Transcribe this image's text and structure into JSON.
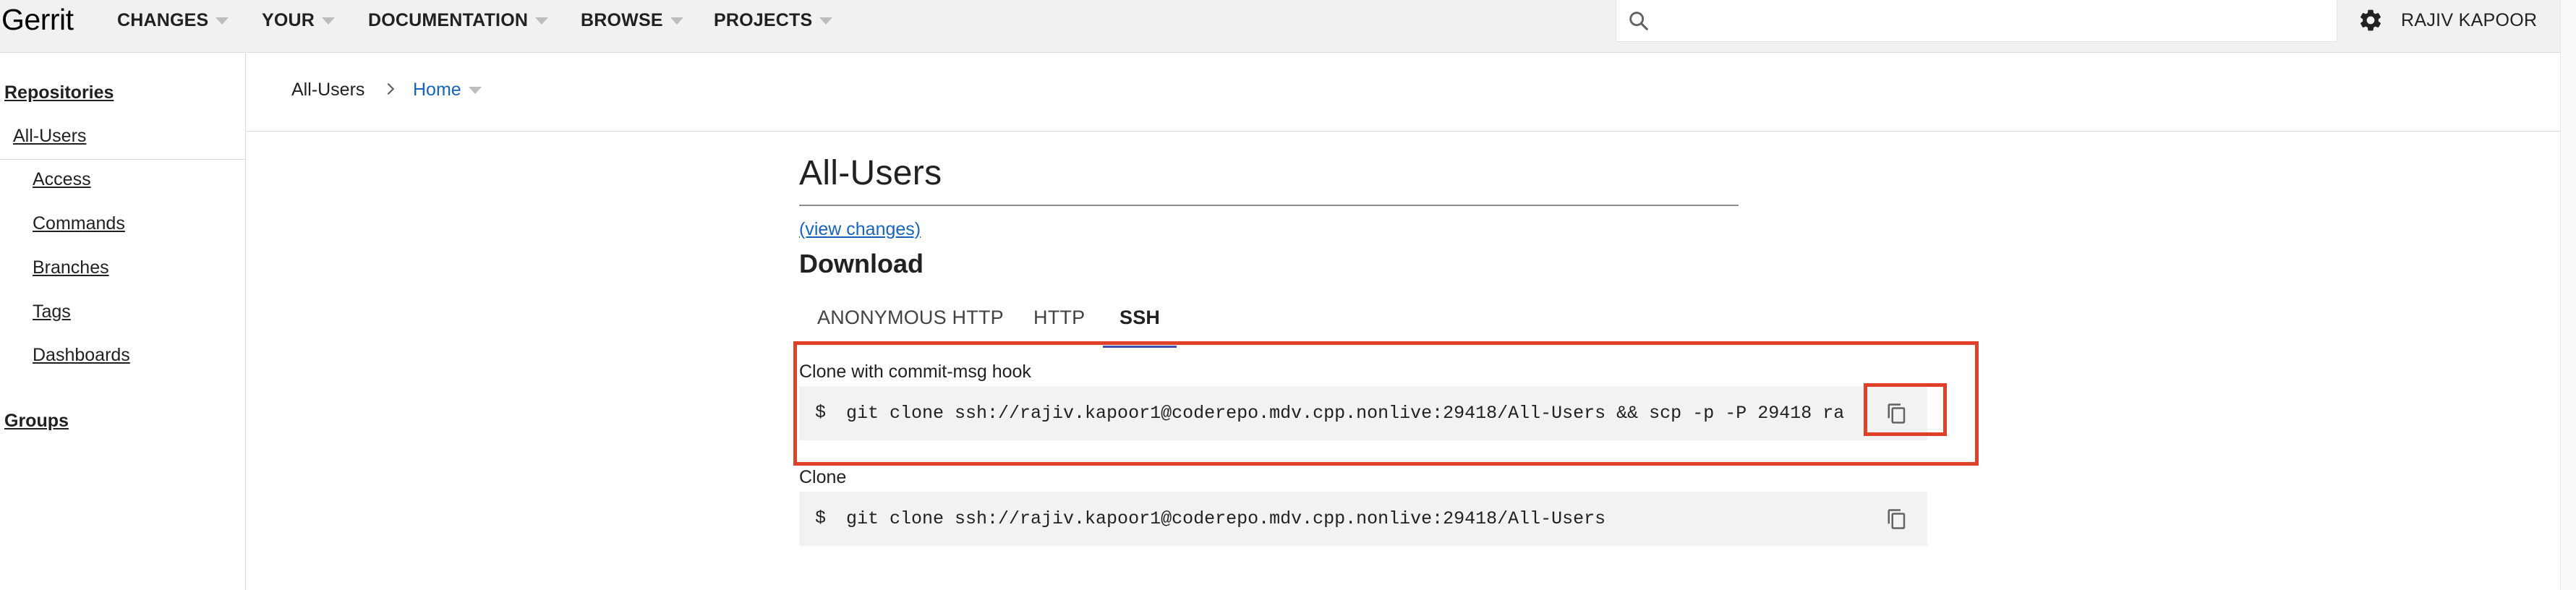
{
  "header": {
    "logo": "Gerrit",
    "nav": [
      {
        "label": "CHANGES"
      },
      {
        "label": "YOUR"
      },
      {
        "label": "DOCUMENTATION"
      },
      {
        "label": "BROWSE"
      },
      {
        "label": "PROJECTS"
      }
    ],
    "search_placeholder": "",
    "user_name": "RAJIV KAPOOR",
    "icons": {
      "search": "search-icon",
      "settings": "gear-icon",
      "dropdown": "caret-down-icon"
    }
  },
  "sidebar": {
    "repositories_heading": "Repositories",
    "selected_repo": "All-Users",
    "items": [
      {
        "label": "Access"
      },
      {
        "label": "Commands"
      },
      {
        "label": "Branches"
      },
      {
        "label": "Tags"
      },
      {
        "label": "Dashboards"
      }
    ],
    "groups_heading": "Groups"
  },
  "breadcrumb": {
    "repo": "All-Users",
    "current": "Home"
  },
  "main": {
    "title": "All-Users",
    "view_changes": "(view changes)",
    "download_heading": "Download",
    "tabs": [
      {
        "label": "ANONYMOUS HTTP",
        "active": false
      },
      {
        "label": "HTTP",
        "active": false
      },
      {
        "label": "SSH",
        "active": true
      }
    ],
    "commands": [
      {
        "label": "Clone with commit-msg hook",
        "prefix": "$",
        "value": "git clone ssh://rajiv.kapoor1@coderepo.mdv.cpp.nonlive:29418/All-Users && scp -p -P 29418 ra"
      },
      {
        "label": "Clone",
        "prefix": "$",
        "value": "git clone ssh://rajiv.kapoor1@coderepo.mdv.cpp.nonlive:29418/All-Users"
      }
    ]
  },
  "colors": {
    "accent_link": "#1565c0",
    "tab_underline": "#3f51b5",
    "highlight": "#e0402a",
    "header_bg": "#f1f1f1"
  }
}
